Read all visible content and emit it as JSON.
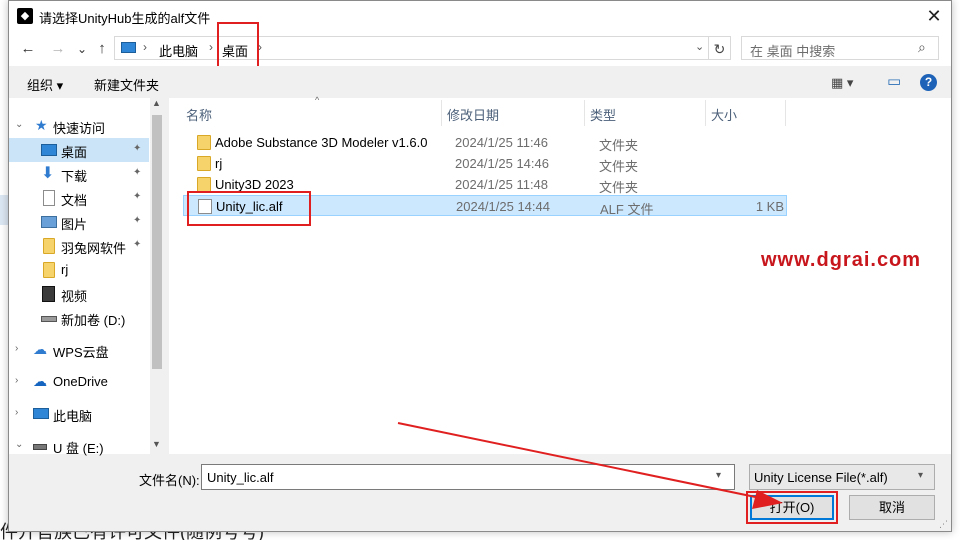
{
  "background": {
    "partial_text": "件开官族已有许可文件(随例号号)"
  },
  "dialog": {
    "title": "请选择UnityHub生成的alf文件",
    "close": "✕"
  },
  "address": {
    "back": "←",
    "forward": "→",
    "recent": "⌄",
    "up": "↑",
    "breadcrumbs": [
      "此电脑",
      "桌面"
    ],
    "refresh": "↻",
    "search_placeholder": "在 桌面 中搜索",
    "search_glyph": "⌕"
  },
  "toolbar": {
    "organize": "组织 ▾",
    "new_folder": "新建文件夹",
    "view": "▦ ▾",
    "pane": "▭",
    "help": "?"
  },
  "nav": {
    "items": [
      {
        "label": "快速访问",
        "icon": "star-icon",
        "chevron": "⌄",
        "pinned": false
      },
      {
        "label": "桌面",
        "icon": "desktop-icon",
        "pinned": true,
        "selected": true
      },
      {
        "label": "下载",
        "icon": "download-icon",
        "pinned": true
      },
      {
        "label": "文档",
        "icon": "document-icon",
        "pinned": true
      },
      {
        "label": "图片",
        "icon": "picture-icon",
        "pinned": true
      },
      {
        "label": "羽兔网软件",
        "icon": "folder-icon",
        "pinned": true
      },
      {
        "label": "rj",
        "icon": "folder-icon",
        "pinned": false
      },
      {
        "label": "视频",
        "icon": "video-icon",
        "pinned": false
      },
      {
        "label": "新加卷 (D:)",
        "icon": "drive-icon",
        "pinned": false
      },
      {
        "label": "WPS云盘",
        "icon": "cloud-icon",
        "chevron": "›",
        "pinned": false
      },
      {
        "label": "OneDrive",
        "icon": "onedrive-icon",
        "chevron": "›",
        "pinned": false
      },
      {
        "label": "此电脑",
        "icon": "computer-icon",
        "chevron": "›",
        "pinned": false
      },
      {
        "label": "U 盘 (E:)",
        "icon": "usb-icon",
        "chevron": "⌄",
        "pinned": false
      }
    ],
    "pin_glyph": "📌"
  },
  "list": {
    "columns": {
      "name": "名称",
      "date": "修改日期",
      "type": "类型",
      "size": "大小"
    },
    "rows": [
      {
        "name": "Adobe Substance 3D Modeler v1.6.0",
        "date": "2024/1/25 11:46",
        "type": "文件夹",
        "size": "",
        "kind": "folder"
      },
      {
        "name": "rj",
        "date": "2024/1/25 14:46",
        "type": "文件夹",
        "size": "",
        "kind": "folder"
      },
      {
        "name": "Unity3D 2023",
        "date": "2024/1/25 11:48",
        "type": "文件夹",
        "size": "",
        "kind": "folder"
      },
      {
        "name": "Unity_lic.alf",
        "date": "2024/1/25 14:44",
        "type": "ALF 文件",
        "size": "1 KB",
        "kind": "file",
        "selected": true
      }
    ]
  },
  "watermark": "www.dgrai.com",
  "bottom": {
    "filename_label": "文件名(N):",
    "filename_value": "Unity_lic.alf",
    "filter": "Unity License File(*.alf)",
    "open": "打开(O)",
    "cancel": "取消"
  },
  "colors": {
    "accent": "#0078d7",
    "highlight": "#e02020",
    "selection": "#cce8ff"
  }
}
